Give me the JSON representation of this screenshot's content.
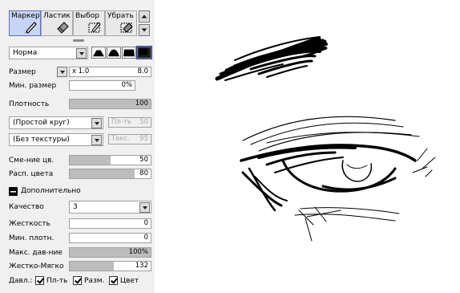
{
  "tools": {
    "marker": "Маркер",
    "eraser": "Ластик",
    "select": "Выбор",
    "remove": "Убрать"
  },
  "blend_mode": "Норма",
  "size": {
    "label": "Размер",
    "multiplier": "x 1.0",
    "value": "8.0"
  },
  "min_size": {
    "label": "Мин. размер",
    "value": "0%"
  },
  "density": {
    "label": "Плотность",
    "value": "100",
    "level": 1.0
  },
  "brush_shape": {
    "value": "(Простой круг)",
    "side_label": "Пл-ть",
    "side_value": "50"
  },
  "texture": {
    "value": "(Без текстуры)",
    "side_label": "Текс.",
    "side_value": "95"
  },
  "color_mix": {
    "label": "Сме-ние цв.",
    "value": "50",
    "level": 0.5
  },
  "color_spread": {
    "label": "Расп. цвета",
    "value": "80",
    "level": 0.8
  },
  "advanced_label": "Дополнительно",
  "quality": {
    "label": "Качество",
    "value": "3"
  },
  "hardness": {
    "label": "Жесткость",
    "value": "0"
  },
  "min_density": {
    "label": "Мин. плотн.",
    "value": "0"
  },
  "max_pressure": {
    "label": "Макс. дав-ние",
    "value": "100%",
    "level": 1.0
  },
  "hard_soft": {
    "label": "Жестко-Мягко",
    "value": "132",
    "level": 0.54
  },
  "pressure": {
    "label": "Давл.:",
    "density": "Пл-ть",
    "size": "Разм.",
    "color": "Цвет"
  }
}
